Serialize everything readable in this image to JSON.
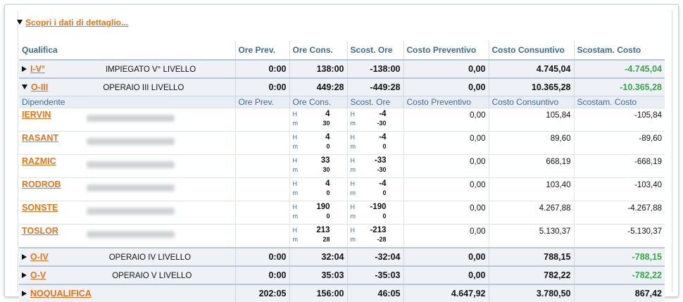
{
  "discover_label": "Scopri i dati di dettaglio...",
  "headers": [
    "Qualifica",
    "Ore Prev.",
    "Ore Cons.",
    "Scost. Ore",
    "Costo Preventivo",
    "Costo Consuntivo",
    "Scostam. Costo"
  ],
  "sub_headers": [
    "Dipendente",
    "Ore Prev.",
    "Ore Cons.",
    "Scost. Ore",
    "Costo Preventivo",
    "Costo Consuntivo",
    "Scostam. Costo"
  ],
  "hm_labels": {
    "h": "H",
    "m": "m"
  },
  "groups": [
    {
      "code": "I-V°",
      "desc": "IMPIEGATO V° LIVELLO",
      "ore_prev": "0:00",
      "ore_cons": "138:00",
      "scost_ore": "-138:00",
      "costo_prev": "0,00",
      "costo_cons": "4.745,04",
      "scost_costo": "-4.745,04",
      "expanded": false
    },
    {
      "code": "O-III",
      "desc": "OPERAIO III LIVELLO",
      "ore_prev": "0:00",
      "ore_cons": "449:28",
      "scost_ore": "-449:28",
      "costo_prev": "0,00",
      "costo_cons": "10.365,28",
      "scost_costo": "-10.365,28",
      "expanded": true
    },
    {
      "code": "O-IV",
      "desc": "OPERAIO IV LIVELLO",
      "ore_prev": "0:00",
      "ore_cons": "32:04",
      "scost_ore": "-32:04",
      "costo_prev": "0,00",
      "costo_cons": "788,15",
      "scost_costo": "-788,15",
      "expanded": false
    },
    {
      "code": "O-V",
      "desc": "OPERAIO V LIVELLO",
      "ore_prev": "0:00",
      "ore_cons": "35:03",
      "scost_ore": "-35:03",
      "costo_prev": "0,00",
      "costo_cons": "782,22",
      "scost_costo": "-782,22",
      "expanded": false
    },
    {
      "code": "NOQUALIFICA",
      "desc": "",
      "ore_prev": "202:05",
      "ore_cons": "156:00",
      "scost_ore": "46:05",
      "costo_prev": "4.647,92",
      "costo_cons": "3.780,50",
      "scost_costo": "867,42",
      "expanded": false
    }
  ],
  "employees": [
    {
      "code": "IERVIN",
      "cons_h": "4",
      "cons_m": "30",
      "scost_h": "-4",
      "scost_m": "-30",
      "costo_prev": "0,00",
      "costo_cons": "105,84",
      "scost_costo": "-105,84"
    },
    {
      "code": "RASANT",
      "cons_h": "4",
      "cons_m": "0",
      "scost_h": "-4",
      "scost_m": "0",
      "costo_prev": "0,00",
      "costo_cons": "89,60",
      "scost_costo": "-89,60"
    },
    {
      "code": "RAZMIC",
      "cons_h": "33",
      "cons_m": "30",
      "scost_h": "-33",
      "scost_m": "-30",
      "costo_prev": "0,00",
      "costo_cons": "668,19",
      "scost_costo": "-668,19"
    },
    {
      "code": "RODROB",
      "cons_h": "4",
      "cons_m": "0",
      "scost_h": "-4",
      "scost_m": "0",
      "costo_prev": "0,00",
      "costo_cons": "103,40",
      "scost_costo": "-103,40"
    },
    {
      "code": "SONSTE",
      "cons_h": "190",
      "cons_m": "0",
      "scost_h": "-190",
      "scost_m": "0",
      "costo_prev": "0,00",
      "costo_cons": "4.267,88",
      "scost_costo": "-4.267,88"
    },
    {
      "code": "TOSLOR",
      "cons_h": "213",
      "cons_m": "28",
      "scost_h": "-213",
      "scost_m": "-28",
      "costo_prev": "0,00",
      "costo_cons": "5.130,37",
      "scost_costo": "-5.130,37"
    }
  ],
  "colors": {
    "link": "#e8731a",
    "header": "#3d6b98",
    "positive_variance": "#3aa54a",
    "group_bg": "#eef2f7"
  }
}
